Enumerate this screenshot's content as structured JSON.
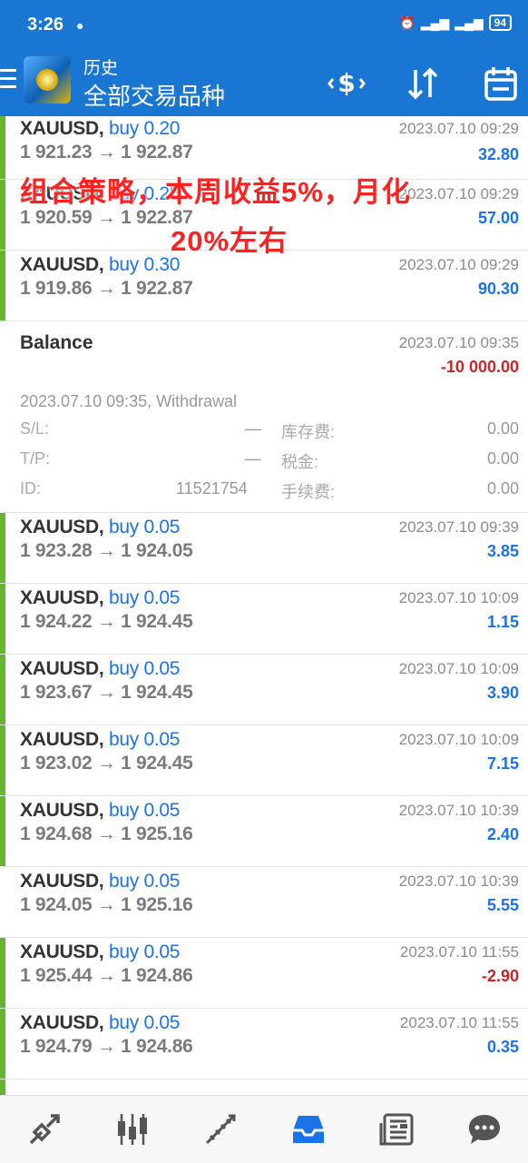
{
  "status_bar": {
    "time": "3:26",
    "battery": "94"
  },
  "header": {
    "title_small": "历史",
    "title_big": "全部交易品种"
  },
  "overlay": {
    "line1": "组合策略，本周收益5%，月化",
    "line2": "20%左右"
  },
  "trades_top": [
    {
      "symbol": "XAUUSD,",
      "dir": "buy 0.20",
      "prices": "1 921.23 → 1 922.87",
      "date": "2023.07.10 09:29",
      "profit": "32.80"
    },
    {
      "symbol": "XAUUSD,",
      "dir": "buy 0.25",
      "prices": "1 920.59 → 1 922.87",
      "date": "2023.07.10 09:29",
      "profit": "57.00"
    },
    {
      "symbol": "XAUUSD,",
      "dir": "buy 0.30",
      "prices": "1 919.86 → 1 922.87",
      "date": "2023.07.10 09:29",
      "profit": "90.30"
    }
  ],
  "balance": {
    "title": "Balance",
    "date": "2023.07.10 09:35",
    "amount": "-10 000.00",
    "subtitle": "2023.07.10 09:35, Withdrawal",
    "sl_label": "S/L:",
    "sl_value": "—",
    "tp_label": "T/P:",
    "tp_value": "—",
    "id_label": "ID:",
    "id_value": "11521754",
    "swap_label": "库存费:",
    "swap_value": "0.00",
    "tax_label": "税金:",
    "tax_value": "0.00",
    "fee_label": "手续费:",
    "fee_value": "0.00"
  },
  "trades_bottom": [
    {
      "symbol": "XAUUSD,",
      "dir": "buy 0.05",
      "prices": "1 923.28 → 1 924.05",
      "date": "2023.07.10 09:39",
      "profit": "3.85"
    },
    {
      "symbol": "XAUUSD,",
      "dir": "buy 0.05",
      "prices": "1 924.22 → 1 924.45",
      "date": "2023.07.10 10:09",
      "profit": "1.15"
    },
    {
      "symbol": "XAUUSD,",
      "dir": "buy 0.05",
      "prices": "1 923.67 → 1 924.45",
      "date": "2023.07.10 10:09",
      "profit": "3.90"
    },
    {
      "symbol": "XAUUSD,",
      "dir": "buy 0.05",
      "prices": "1 923.02 → 1 924.45",
      "date": "2023.07.10 10:09",
      "profit": "7.15"
    },
    {
      "symbol": "XAUUSD,",
      "dir": "buy 0.05",
      "prices": "1 924.68 → 1 925.16",
      "date": "2023.07.10 10:39",
      "profit": "2.40"
    },
    {
      "symbol": "XAUUSD,",
      "dir": "buy 0.05",
      "prices": "1 924.05 → 1 925.16",
      "date": "2023.07.10 10:39",
      "profit": "5.55"
    },
    {
      "symbol": "XAUUSD,",
      "dir": "buy 0.05",
      "prices": "1 925.44 → 1 924.86",
      "date": "2023.07.10 11:55",
      "profit": "-2.90"
    },
    {
      "symbol": "XAUUSD,",
      "dir": "buy 0.05",
      "prices": "1 924.79 → 1 924.86",
      "date": "2023.07.10 11:55",
      "profit": "0.35"
    }
  ],
  "bottom_nav": [
    "quotes-icon",
    "chart-icon",
    "trade-icon",
    "history-icon",
    "news-icon",
    "chat-icon"
  ],
  "colors": {
    "primary": "#1976d2",
    "buy": "#1a73e8",
    "loss": "#c62828",
    "bar": "#64b52f",
    "overlay": "#ff2020"
  }
}
